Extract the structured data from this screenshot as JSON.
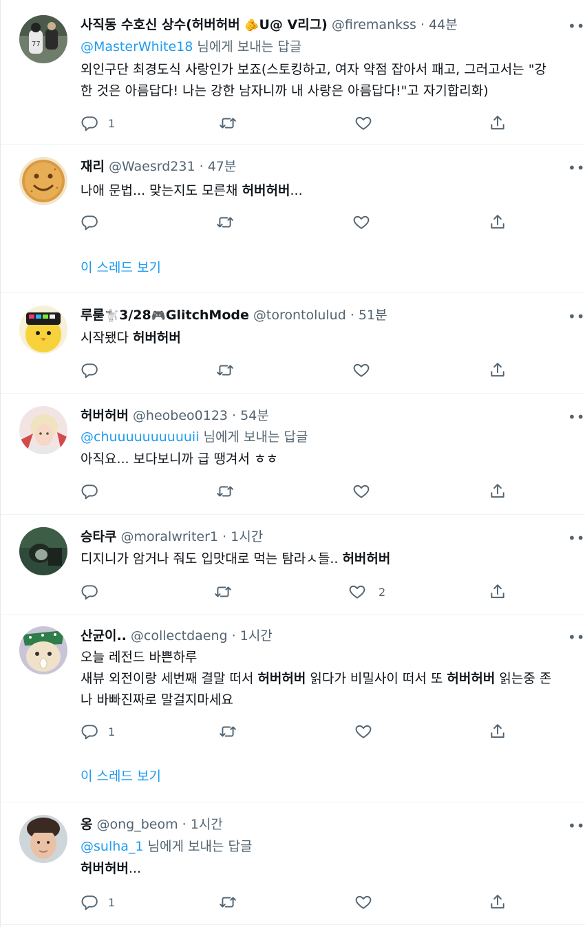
{
  "tweets": [
    {
      "name": "사직동 수호신 상수(허버허버 ",
      "name_emoji": "🫵",
      "name_rest": "U@ V리그)",
      "handle": "@firemankss",
      "time": "44분",
      "reply_mention": "@MasterWhite18",
      "reply_suffix": " 님에게 보내는 답글",
      "text_lines": [
        "외인구단 최경도식 사랑인가 보죠(스토킹하고, 여자 약점 잡아서 패고, 그러고서는 \"강",
        "한 것은 아름답다! 나는 강한 남자니까 내 사랑은 아름답다!\"고 자기합리화)"
      ],
      "reply_count": "1",
      "like_count": ""
    },
    {
      "name": "재리",
      "handle": "@Waesrd231",
      "time": "47분",
      "text_pre": "나애 문법... 맞는지도 모른채 ",
      "text_bold": "허버허버",
      "text_post": "...",
      "thread_link": "이 스레드 보기"
    },
    {
      "name": "루룯",
      "name_emoji": "🐩",
      "name_rest": "3/28",
      "name_emoji2": "🎮",
      "name_rest2": "GlitchMode",
      "handle": "@torontolulud",
      "time": "51분",
      "text_pre": "시작됐다 ",
      "text_bold": "허버허버"
    },
    {
      "name": "허버허버",
      "handle": "@heobeo0123",
      "time": "54분",
      "reply_mention": "@chuuuuuuuuuuii",
      "reply_suffix": " 님에게 보내는 답글",
      "text": "아직요... 보다보니까 급 땡겨서 ㅎㅎ"
    },
    {
      "name": "승타쿠",
      "handle": "@moralwriter1",
      "time": "1시간",
      "text_pre": "디지니가 암거나 줘도 입맛대로 먹는 탐라ㅅ들.. ",
      "text_bold": "허버허버",
      "like_count": "2"
    },
    {
      "name": "산균이..",
      "handle": "@collectdaeng",
      "time": "1시간",
      "line1": "오늘 레전드 바쁜하루",
      "line2_pre": "새뷰 외전이랑 세번째 결말 떠서 ",
      "line2_b1": "허버허버",
      "line2_mid": " 읽다가 비밀사이 떠서 또 ",
      "line2_b2": "허버허버",
      "line2_post": " 읽는중 존",
      "line3": "나 바빠진짜로 말걸지마세요",
      "reply_count": "1",
      "thread_link": "이 스레드 보기"
    },
    {
      "name": "옹",
      "handle": "@ong_beom",
      "time": "1시간",
      "reply_mention": "@sulha_1",
      "reply_suffix": " 님에게 보내는 답글",
      "text_bold": "허버허버",
      "text_post": "...",
      "reply_count": "1"
    }
  ],
  "separator": " · ",
  "more_glyph": "•••",
  "colors": {
    "link": "#1d9bf0",
    "muted": "#536471",
    "text": "#0f1419",
    "border": "#eff3f4"
  },
  "icons": [
    "reply-icon",
    "retweet-icon",
    "like-icon",
    "share-icon",
    "more-icon"
  ]
}
